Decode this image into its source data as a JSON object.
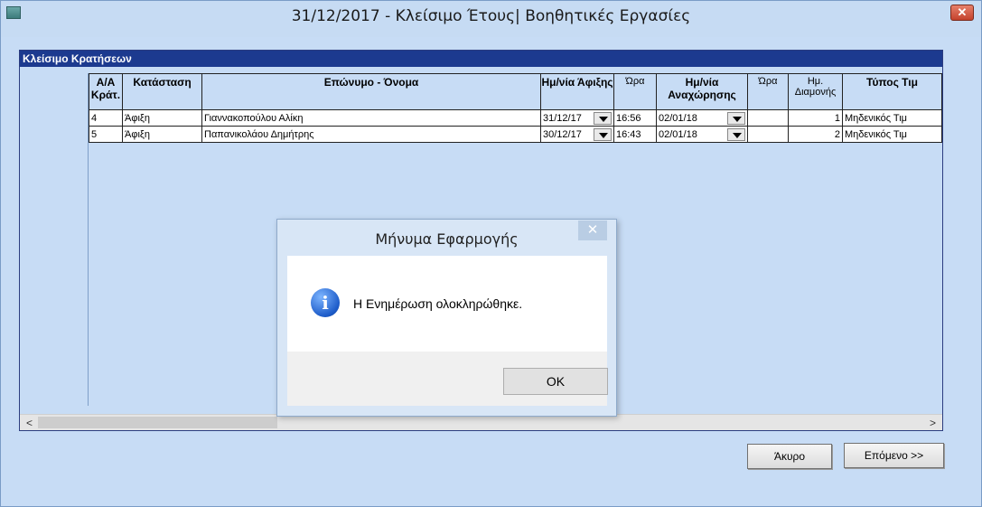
{
  "window": {
    "title": "31/12/2017 - Κλείσιμο Έτους| Βοηθητικές Εργασίες",
    "close_glyph": "✕"
  },
  "panel": {
    "title": "Κλείσιμο Κρατήσεων"
  },
  "grid": {
    "columns": [
      "Α/Α Κράτ.",
      "Κατάσταση",
      "Επώνυμο - Όνομα",
      "Ημ/νία Άφιξης",
      "Ώρα",
      "Ημ/νία Αναχώρησης",
      "Ώρα",
      "Ημ. Διαμονής",
      "Τύπος Τιμ"
    ],
    "rows": [
      {
        "aa": "4",
        "status": "Άφιξη",
        "name": "Γιαννακοπούλου Αλίκη",
        "arrival": "31/12/17",
        "arrival_time": "16:56",
        "departure": "02/01/18",
        "departure_time": "",
        "days": "1",
        "price_type": "Μηδενικός Τιμ"
      },
      {
        "aa": "5",
        "status": "Άφιξη",
        "name": "Παπανικολάου Δημήτρης",
        "arrival": "30/12/17",
        "arrival_time": "16:43",
        "departure": "02/01/18",
        "departure_time": "",
        "days": "2",
        "price_type": "Μηδενικός Τιμ"
      }
    ]
  },
  "scrollbar": {
    "left_arrow": "<",
    "right_arrow": ">"
  },
  "buttons": {
    "cancel": "Άκυρο",
    "next": "Επόμενο >>"
  },
  "dialog": {
    "title": "Μήνυμα Εφαρμογής",
    "close_glyph": "✕",
    "icon": "info-icon",
    "icon_glyph": "i",
    "message": "Η Ενημέρωση ολοκληρώθηκε.",
    "ok": "OK"
  }
}
